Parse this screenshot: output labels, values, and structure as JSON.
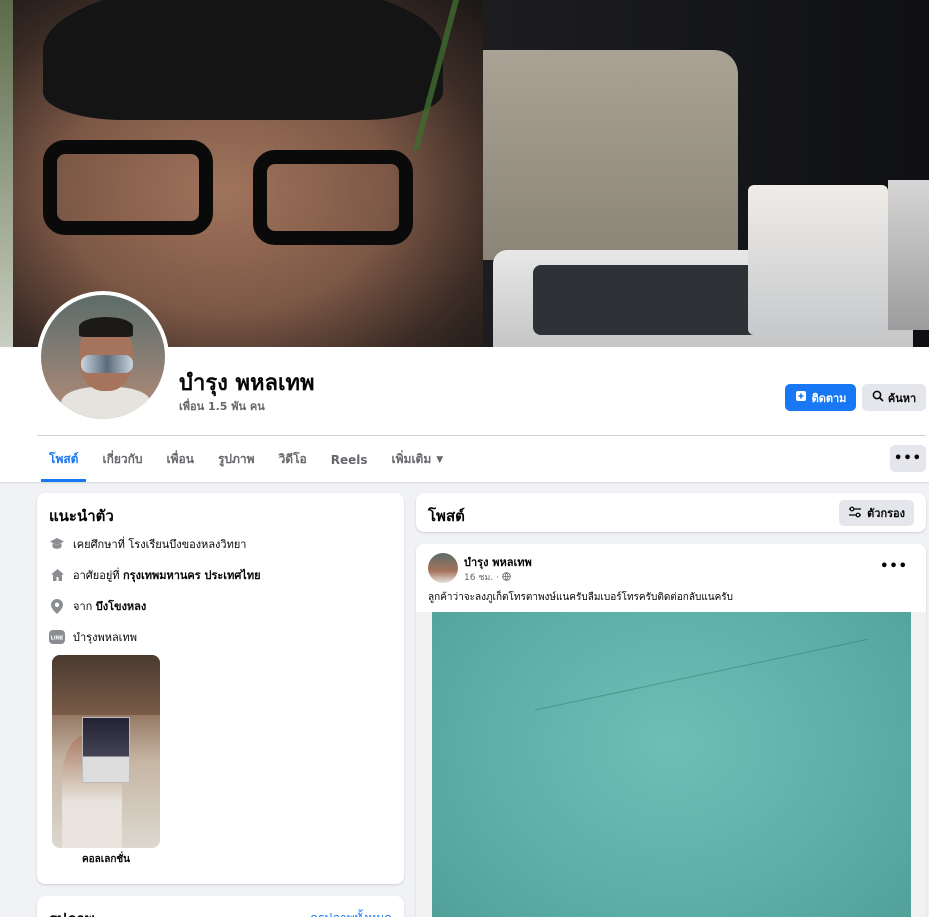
{
  "profile": {
    "name": "บำรุง พหลเทพ",
    "friends": "เพื่อน 1.5 พัน คน"
  },
  "actions": {
    "follow_label": "ติดตาม",
    "search_label": "ค้นหา",
    "more_label": "•••"
  },
  "tabs": [
    {
      "label": "โพสต์"
    },
    {
      "label": "เกี่ยวกับ"
    },
    {
      "label": "เพื่อน"
    },
    {
      "label": "รูปภาพ"
    },
    {
      "label": "วิดีโอ"
    },
    {
      "label": "Reels"
    },
    {
      "label": "เพิ่มเติม"
    }
  ],
  "intro": {
    "title": "แนะนำตัว",
    "education": {
      "prefix": "เคยศึกษาที่ ",
      "value": "โรงเรียนบึงของหลงวิทยา"
    },
    "lives": {
      "prefix": "อาศัยอยู่ที่ ",
      "value": "กรุงเทพมหานคร ประเทศไทย"
    },
    "from": {
      "prefix": "จาก ",
      "value": "บึงโขงหลง"
    },
    "line": {
      "icon_text": "LINE",
      "value": "บำรุงพหลเทพ"
    },
    "collection_label": "คอลเลกชั่น"
  },
  "photos": {
    "title": "รูปภาพ",
    "see_all": "ดูรูปภาพทั้งหมด"
  },
  "posts": {
    "title": "โพสต์",
    "filter_label": "ตัวกรอง"
  },
  "post": {
    "author": "บำรุง พหลเทพ",
    "time": "16 ชม. · ",
    "text": "ลูกค้าว่าจะลงภูเก็ตโทรตาพงษ์แนครับลืมเบอร์โทรครับติดต่อกลับแนครับ"
  },
  "colors": {
    "accent": "#1877f2",
    "background": "#f0f2f5",
    "secondary_text": "#65676b"
  }
}
